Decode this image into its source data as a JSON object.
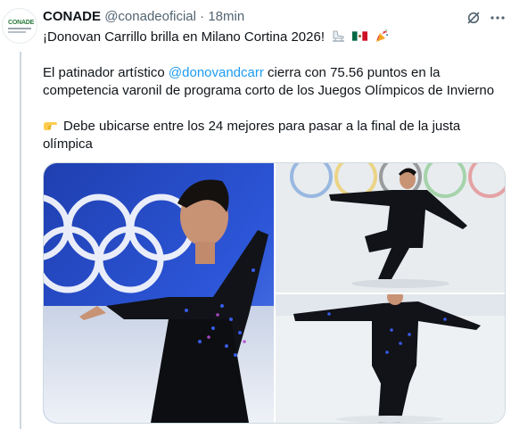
{
  "tweet": {
    "author_name": "CONADE",
    "handle": "@conadeoficial",
    "separator": "·",
    "time": "18min",
    "avatar_text": "CONADE",
    "line1": "¡Donovan Carrillo brilla en Milano Cortina 2026!",
    "line2_pre": "El patinador artístico ",
    "mention": "@donovandcarr",
    "line2_post": " cierra con 75.56 puntos en la",
    "line3": "competencia varonil de programa corto de los Juegos Olímpicos de Invierno",
    "line4": "Debe ubicarse entre los 24 mejores para pasar a la final de la justa",
    "line5": "olímpica"
  },
  "icons": {
    "grok": "grok-icon",
    "more": "more-icon",
    "skate": "ice-skate-icon",
    "flag": "mexico-flag-icon",
    "party": "party-popper-icon",
    "pointing": "backhand-index-pointing-right-icon"
  },
  "colors": {
    "link": "#1d9bf0",
    "secondary_text": "#536471",
    "primary_text": "#0f1419"
  }
}
